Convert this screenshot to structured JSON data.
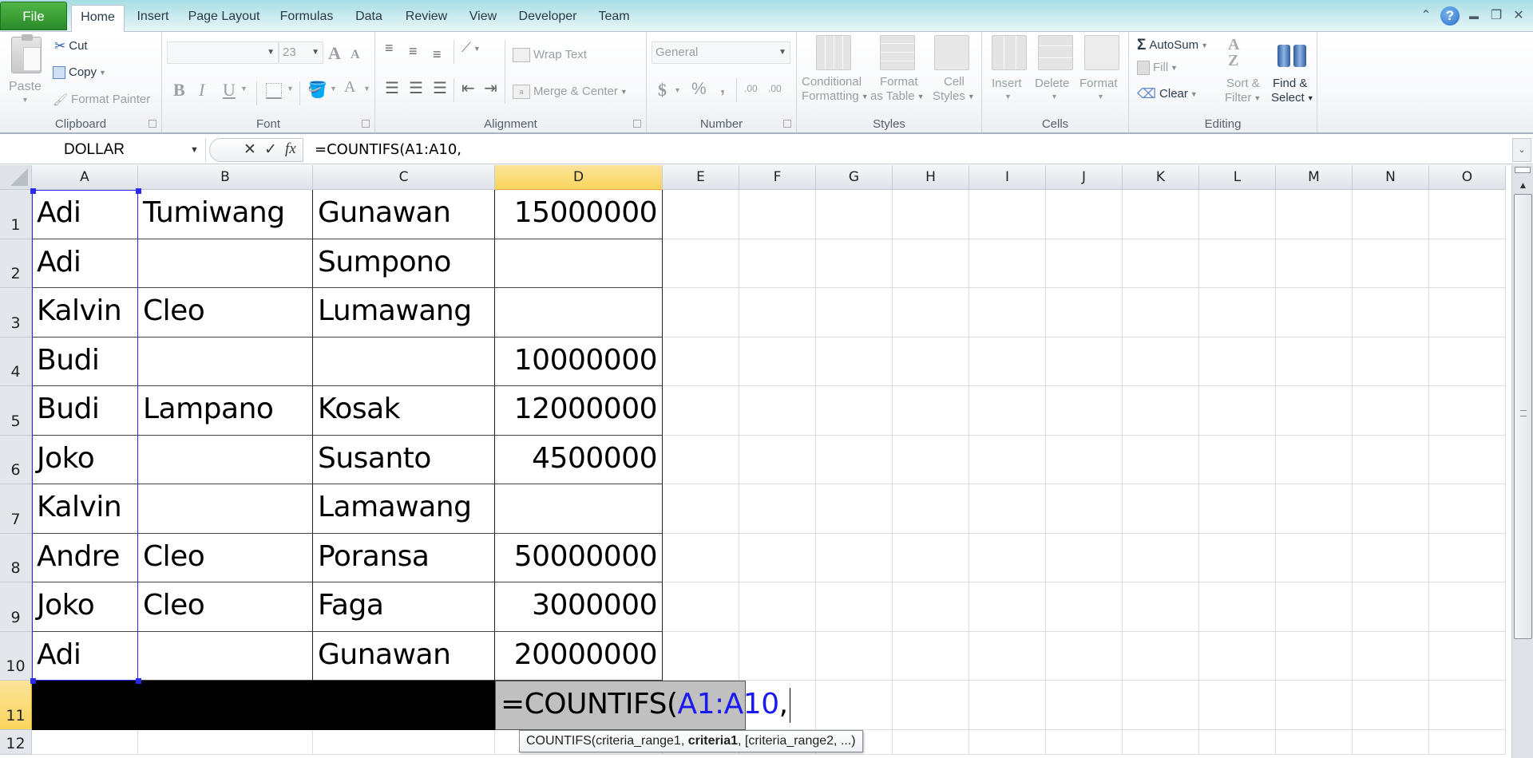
{
  "tabs": {
    "file": "File",
    "items": [
      "Home",
      "Insert",
      "Page Layout",
      "Formulas",
      "Data",
      "Review",
      "View",
      "Developer",
      "Team"
    ],
    "active": "Home"
  },
  "window_controls": {
    "minimize_ribbon": "⌃",
    "help": "?",
    "minimize": "▬",
    "restore": "❐",
    "close": "✕"
  },
  "ribbon": {
    "clipboard": {
      "label": "Clipboard",
      "paste": "Paste",
      "cut": "Cut",
      "copy": "Copy",
      "format_painter": "Format Painter"
    },
    "font": {
      "label": "Font",
      "font_name": "",
      "font_size": "23",
      "grow": "A",
      "shrink": "A",
      "bold": "B",
      "italic": "I",
      "underline": "U",
      "font_color": "A"
    },
    "alignment": {
      "label": "Alignment",
      "wrap_text": "Wrap Text",
      "merge_center": "Merge & Center"
    },
    "number": {
      "label": "Number",
      "format": "General",
      "currency": "$",
      "percent": "%",
      "comma": ",",
      "inc_decimal": ".00",
      "dec_decimal": ".00"
    },
    "styles": {
      "label": "Styles",
      "conditional_formatting_1": "Conditional",
      "conditional_formatting_2": "Formatting",
      "format_table_1": "Format",
      "format_table_2": "as Table",
      "cell_styles_1": "Cell",
      "cell_styles_2": "Styles"
    },
    "cells": {
      "label": "Cells",
      "insert": "Insert",
      "delete": "Delete",
      "format": "Format"
    },
    "editing": {
      "label": "Editing",
      "autosum": "AutoSum",
      "fill": "Fill",
      "clear": "Clear",
      "sort_filter_1": "Sort &",
      "sort_filter_2": "Filter",
      "find_select_1": "Find &",
      "find_select_2": "Select"
    }
  },
  "formula_bar": {
    "name_box": "DOLLAR",
    "cancel": "✕",
    "enter": "✓",
    "fx": "fx",
    "formula": "=COUNTIFS(A1:A10,"
  },
  "sheet": {
    "columns": [
      "A",
      "B",
      "C",
      "D",
      "E",
      "F",
      "G",
      "H",
      "I",
      "J",
      "K",
      "L",
      "M",
      "N",
      "O"
    ],
    "selected_column": "D",
    "row_numbers": [
      "1",
      "2",
      "3",
      "4",
      "5",
      "6",
      "7",
      "8",
      "9",
      "10",
      "11",
      "12"
    ],
    "selected_row": "11",
    "rows": [
      [
        "Adi",
        "Tumiwang",
        "Gunawan",
        "15000000"
      ],
      [
        "Adi",
        "",
        "Sumpono",
        ""
      ],
      [
        "Kalvin",
        "Cleo",
        "Lumawang",
        ""
      ],
      [
        "Budi",
        "",
        "",
        "10000000"
      ],
      [
        "Budi",
        "Lampano",
        "Kosak",
        "12000000"
      ],
      [
        "Joko",
        "",
        "Susanto",
        "4500000"
      ],
      [
        "Kalvin",
        "",
        "Lamawang",
        ""
      ],
      [
        "Andre",
        "Cleo",
        "Poransa",
        "50000000"
      ],
      [
        "Joko",
        "Cleo",
        "Faga",
        "3000000"
      ],
      [
        "Adi",
        "",
        "Gunawan",
        "20000000"
      ]
    ],
    "editing_cell": {
      "address": "D11",
      "prefix": "=COUNTIFS(",
      "ref": "A1:A10",
      "suffix": ","
    },
    "referenced_range": "A1:A10",
    "tooltip": {
      "func": "COUNTIFS(criteria_range1, ",
      "current_arg": "criteria1",
      "rest": ", [criteria_range2, ...)"
    }
  },
  "colors": {
    "file_tab": "#2a8b2a",
    "selected_header": "#f9d65d",
    "reference_blue": "#1a1af0",
    "editing_cell_bg": "#c0c0c0"
  }
}
